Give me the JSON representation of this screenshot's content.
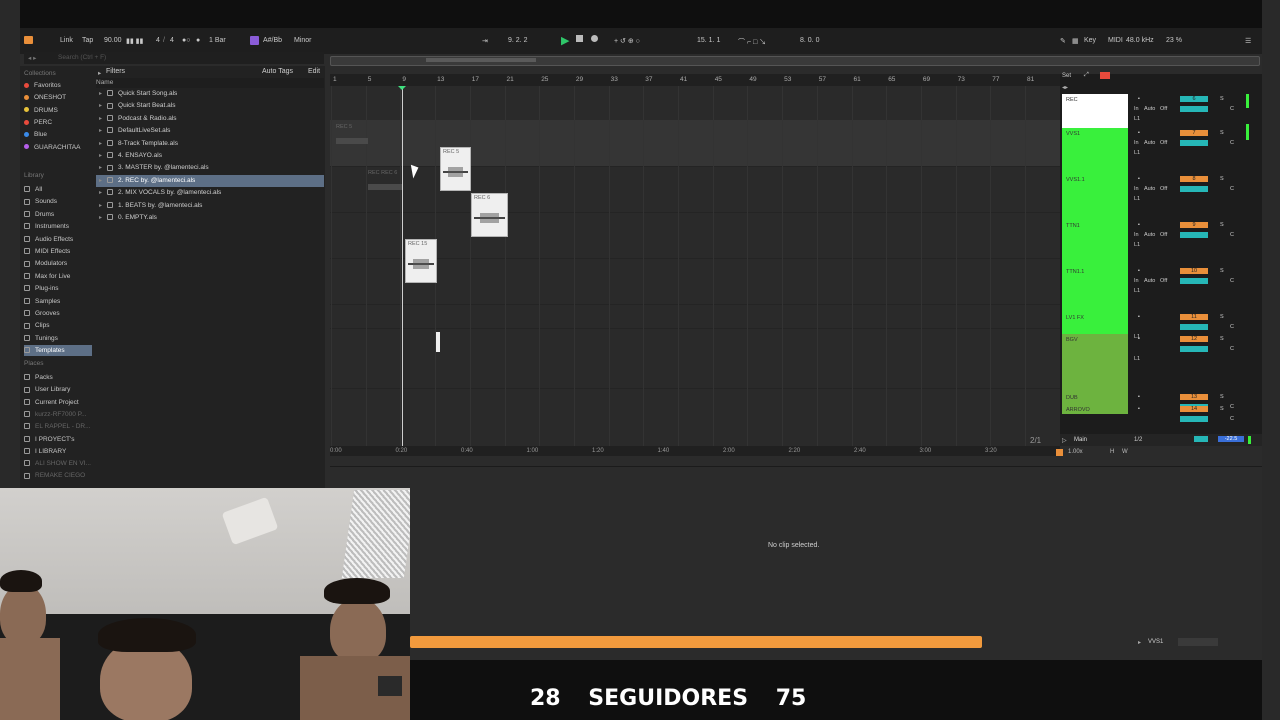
{
  "toolbar": {
    "link": "Link",
    "tap": "Tap",
    "tempo": "90.00",
    "time_sig_num": "4",
    "time_sig_den": "4",
    "metronome": "1 Bar",
    "scale_root": "A#/Bb",
    "scale_mode": "Minor",
    "position": "9.  2.  2",
    "loop_start": "15.  1.  1",
    "loop_length": "8.  0.  0",
    "key": "Key",
    "midi": "MIDI",
    "sample_rate": "48.0 kHz",
    "cpu": "23 %"
  },
  "browser": {
    "search_placeholder": "Search (Ctrl + F)",
    "filters": "Filters",
    "auto_tags": "Auto Tags",
    "edit": "Edit",
    "name_header": "Name",
    "collections_header": "Collections",
    "collections": [
      {
        "label": "Favoritos",
        "color": "#e84a3c"
      },
      {
        "label": "ONESHOT",
        "color": "#e98f3a"
      },
      {
        "label": "DRUMS",
        "color": "#e7c23a"
      },
      {
        "label": "PERC",
        "color": "#e84a3c"
      },
      {
        "label": "Blue",
        "color": "#3a8ae8"
      },
      {
        "label": "GUARACHITAA",
        "color": "#b45ee8"
      }
    ],
    "library_header": "Library",
    "library": [
      "All",
      "Sounds",
      "Drums",
      "Instruments",
      "Audio Effects",
      "MIDI Effects",
      "Modulators",
      "Max for Live",
      "Plug-ins",
      "Samples",
      "Grooves",
      "Clips",
      "Tunings",
      "Templates"
    ],
    "places_header": "Places",
    "places": [
      "Packs",
      "User Library",
      "Current Project",
      "kurzz-RF7000 P...",
      "EL RAPPEL - DR...",
      "I PROYECT's",
      "I LIBRARY",
      "ALI SHOW EN VI...",
      "REMAKE CIEGO"
    ],
    "files": [
      "Quick Start Song.als",
      "Quick Start Beat.als",
      "Podcast & Radio.als",
      "DefaultLiveSet.als",
      "8-Track Template.als",
      "4. ENSAYO.als",
      "3. MASTER by. @lamenteci.als",
      "2. REC by. @lamenteci.als",
      "2. MIX VOCALS by. @lamenteci.als",
      "1. BEATS by. @lamenteci.als",
      "0. EMPTY.als"
    ]
  },
  "arrangement": {
    "bar_numbers": [
      "1",
      "5",
      "9",
      "13",
      "17",
      "21",
      "25",
      "29",
      "33",
      "37",
      "41",
      "45",
      "49",
      "53",
      "57",
      "61",
      "65",
      "69",
      "73",
      "77",
      "81"
    ],
    "clips": [
      {
        "name": "REC 5"
      },
      {
        "name": "REC 6"
      },
      {
        "name": "REC 15"
      }
    ],
    "ghost_labels": [
      "REC 5",
      "REC REC 6"
    ],
    "timeline": [
      "0:00",
      "0:20",
      "0:40",
      "1:00",
      "1:20",
      "1:40",
      "2:00",
      "2:20",
      "2:40",
      "3:00",
      "3:20"
    ],
    "page_indicator": "2/1"
  },
  "mixer": {
    "set_label": "Set",
    "tracks": [
      {
        "name": "REC",
        "number": "6",
        "header_color": "#ffffff"
      },
      {
        "name": "VVS1",
        "number": "7",
        "header_color": "#39f03c"
      },
      {
        "name": "VVS1.1",
        "number": "8",
        "header_color": "#39f03c"
      },
      {
        "name": "TTN1",
        "number": "9",
        "header_color": "#39f03c"
      },
      {
        "name": "TTN1.1",
        "number": "10",
        "header_color": "#39f03c"
      },
      {
        "name": "LV1 FX",
        "number": "11",
        "header_color": "#39f03c"
      },
      {
        "name": "BGV",
        "number": "12",
        "header_color": "#6db33f"
      },
      {
        "name": "DUB",
        "number": "13",
        "header_color": "#6db33f"
      },
      {
        "name": "ARROVO",
        "number": "14",
        "header_color": "#6db33f"
      }
    ],
    "input_label": "In",
    "auto_label": "Auto",
    "off_label": "Off",
    "channel_label": "L1",
    "main_label": "Main",
    "main_routing": "1/2",
    "main_volume": "-22.5",
    "zoom": "1.00x",
    "h_label": "H",
    "w_label": "W"
  },
  "detail": {
    "message": "No clip selected."
  },
  "statusbar": {
    "track_name": "VVS1"
  },
  "overlay": {
    "count_left": "28",
    "label": "SEGUIDORES",
    "count_right": "75"
  }
}
